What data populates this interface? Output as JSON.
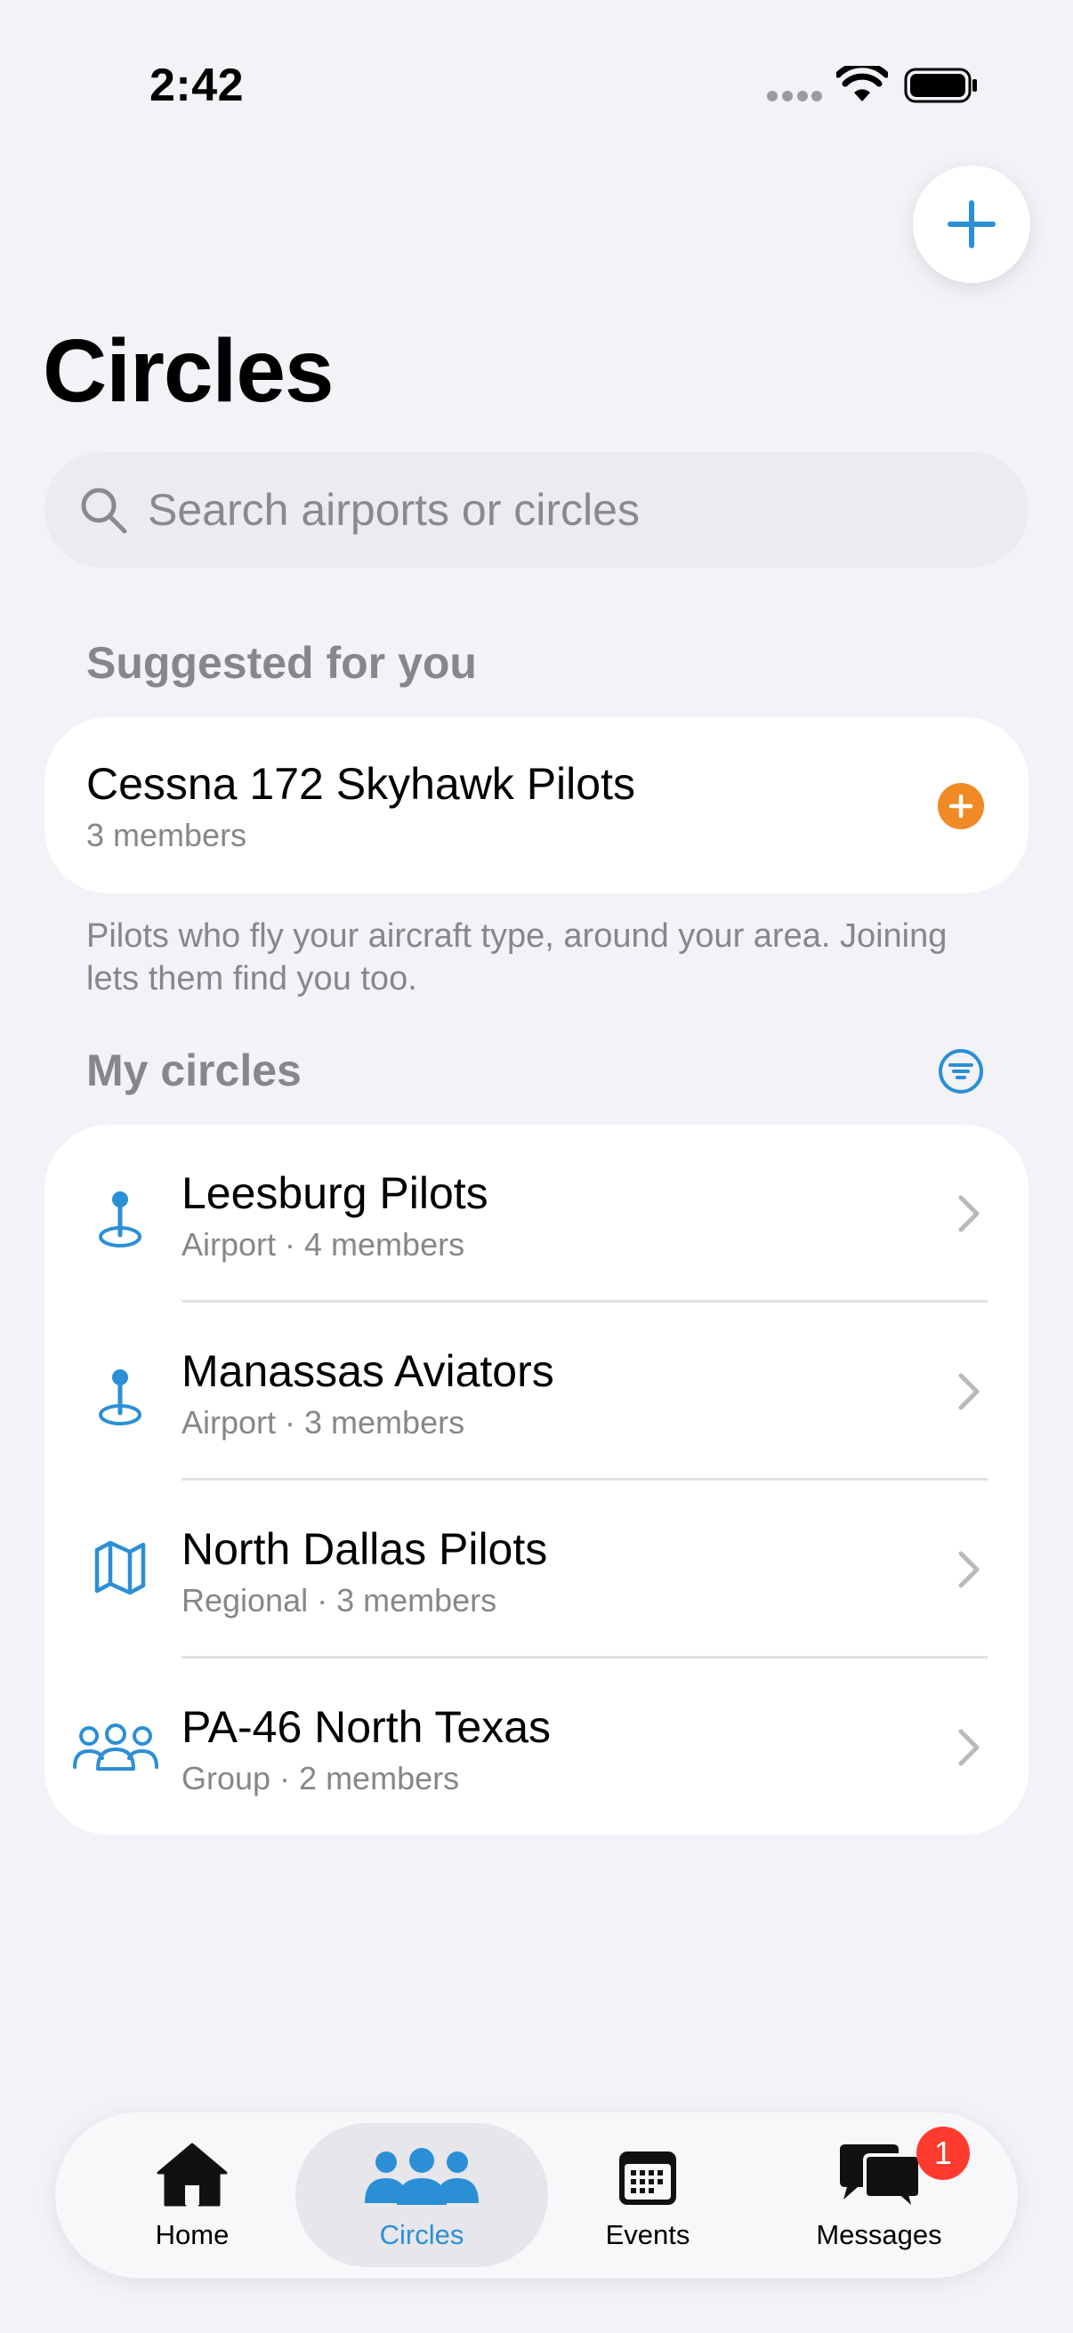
{
  "status_bar": {
    "time": "2:42"
  },
  "header": {
    "title": "Circles"
  },
  "search": {
    "placeholder": "Search airports or circles"
  },
  "suggested": {
    "heading": "Suggested for you",
    "card": {
      "title": "Cessna 172 Skyhawk Pilots",
      "subtitle": "3 members"
    },
    "note": "Pilots who fly your aircraft type, around your area. Joining lets them find you too."
  },
  "my_circles": {
    "heading": "My circles",
    "items": [
      {
        "title": "Leesburg Pilots",
        "subtitle": "Airport · 4 members",
        "icon": "airport-pin-icon"
      },
      {
        "title": "Manassas Aviators",
        "subtitle": "Airport · 3 members",
        "icon": "airport-pin-icon"
      },
      {
        "title": "North Dallas Pilots",
        "subtitle": "Regional · 3 members",
        "icon": "map-icon"
      },
      {
        "title": "PA-46 North Texas",
        "subtitle": "Group · 2 members",
        "icon": "group-icon"
      }
    ]
  },
  "tab_bar": {
    "tabs": [
      {
        "label": "Home",
        "icon": "house-icon"
      },
      {
        "label": "Circles",
        "icon": "people-icon",
        "active": true
      },
      {
        "label": "Events",
        "icon": "calendar-icon"
      },
      {
        "label": "Messages",
        "icon": "chat-bubbles-icon",
        "badge": "1"
      }
    ]
  },
  "colors": {
    "accent": "#2b8fd6",
    "orange": "#f08a24",
    "badge": "#ff3b30",
    "background": "#f2f2f7"
  }
}
